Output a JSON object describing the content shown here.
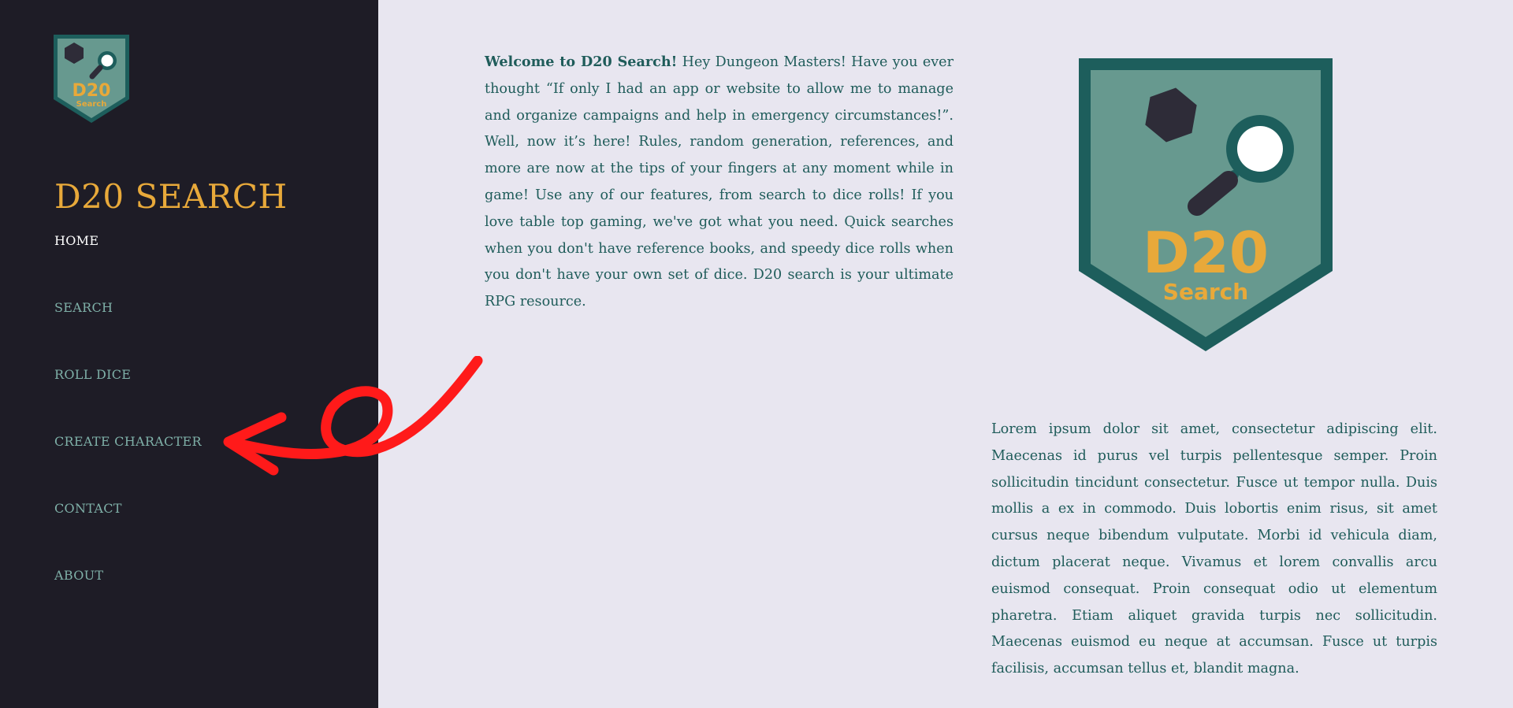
{
  "sidebar": {
    "brand": "D20 SEARCH",
    "logo": {
      "line1": "D20",
      "line2": "Search"
    },
    "nav": [
      {
        "label": "HOME",
        "active": true
      },
      {
        "label": "SEARCH",
        "active": false
      },
      {
        "label": "ROLL DICE",
        "active": false
      },
      {
        "label": "CREATE CHARACTER",
        "active": false
      },
      {
        "label": "CONTACT",
        "active": false
      },
      {
        "label": "ABOUT",
        "active": false
      }
    ]
  },
  "main": {
    "intro_bold": "Welcome to D20 Search!",
    "intro_text": " Hey Dungeon Masters! Have you ever thought “If only I had an app or website to allow me to manage and organize campaigns and help in emergency circumstances!”. Well, now it’s here! Rules, random generation, references, and more are now at the tips of your fingers at any moment while in game! Use any of our features, from search to dice rolls! If you love table top gaming, we've got what you need. Quick searches when you don't have reference books, and speedy dice rolls when you don't have your own set of dice. D20 search is your ultimate RPG resource.",
    "logo": {
      "line1": "D20",
      "line2": "Search"
    },
    "lorem": "Lorem ipsum dolor sit amet, consectetur adipiscing elit. Maecenas id purus vel turpis pellentesque semper. Proin sollicitudin tincidunt consectetur. Fusce ut tempor nulla. Duis mollis a ex in commodo. Duis lobortis enim risus, sit amet cursus neque bibendum vulputate. Morbi id vehicula diam, dictum placerat neque. Vivamus et lorem convallis arcu euismod consequat. Proin consequat odio ut elementum pharetra. Etiam aliquet gravida turpis nec sollicitudin. Maecenas euismod eu neque at accumsan. Fusce ut turpis facilisis, accumsan tellus et, blandit magna."
  },
  "colors": {
    "sidebar_bg": "#1e1c26",
    "page_bg": "#e8e6f0",
    "accent_gold": "#e8a93a",
    "teal_dark": "#1d5e5c",
    "teal_light": "#67998f",
    "nav_text": "#7fb0a8",
    "annotation_red": "#ff1a1a"
  },
  "annotation": {
    "type": "red-hand-drawn-arrow",
    "points_to": "CREATE CHARACTER"
  }
}
